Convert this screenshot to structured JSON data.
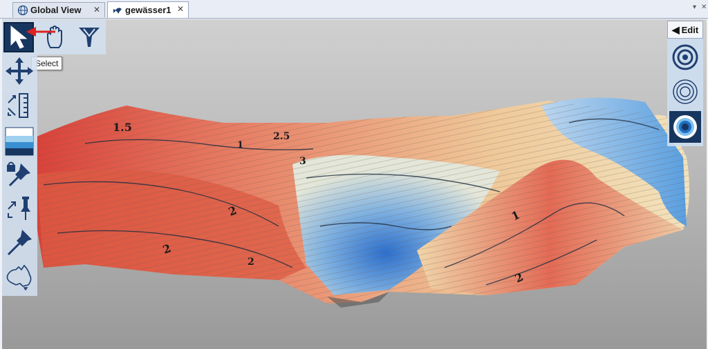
{
  "tabs": [
    {
      "label": "Global View",
      "icon": "globe-icon",
      "active": false
    },
    {
      "label": "gewässer1",
      "icon": "fish-icon",
      "active": true
    }
  ],
  "toolbar": {
    "tools": [
      {
        "name": "select",
        "icon": "cursor-arrow-icon",
        "selected": true
      },
      {
        "name": "pan",
        "icon": "hand-icon"
      },
      {
        "name": "y-tool",
        "icon": "y-shape-icon"
      },
      {
        "name": "move",
        "icon": "move-arrows-icon"
      },
      {
        "name": "scale",
        "icon": "scale-ruler-icon"
      },
      {
        "name": "water-layers",
        "icon": "water-layers-icon"
      },
      {
        "name": "lock-pin",
        "icon": "lock-pin-icon"
      },
      {
        "name": "pin-resize",
        "icon": "pin-resize-icon"
      },
      {
        "name": "pin",
        "icon": "pin-icon"
      },
      {
        "name": "australia-map",
        "icon": "australia-map-icon"
      }
    ],
    "tooltip": "Select"
  },
  "right_panel": {
    "edit_label": "Edit",
    "tools": [
      {
        "icon": "target-rings-icon"
      },
      {
        "icon": "concentric-rings-icon"
      },
      {
        "icon": "filled-rings-icon",
        "selected": true
      }
    ]
  },
  "contour_labels": [
    "1.5",
    "2.5",
    "3",
    "1",
    "2",
    "2",
    "2",
    "1",
    "2"
  ],
  "colors": {
    "accent": "#17365f",
    "shallow": "#d9423a",
    "deep": "#2d72c9",
    "tooltip_arrow": "#e02020"
  }
}
